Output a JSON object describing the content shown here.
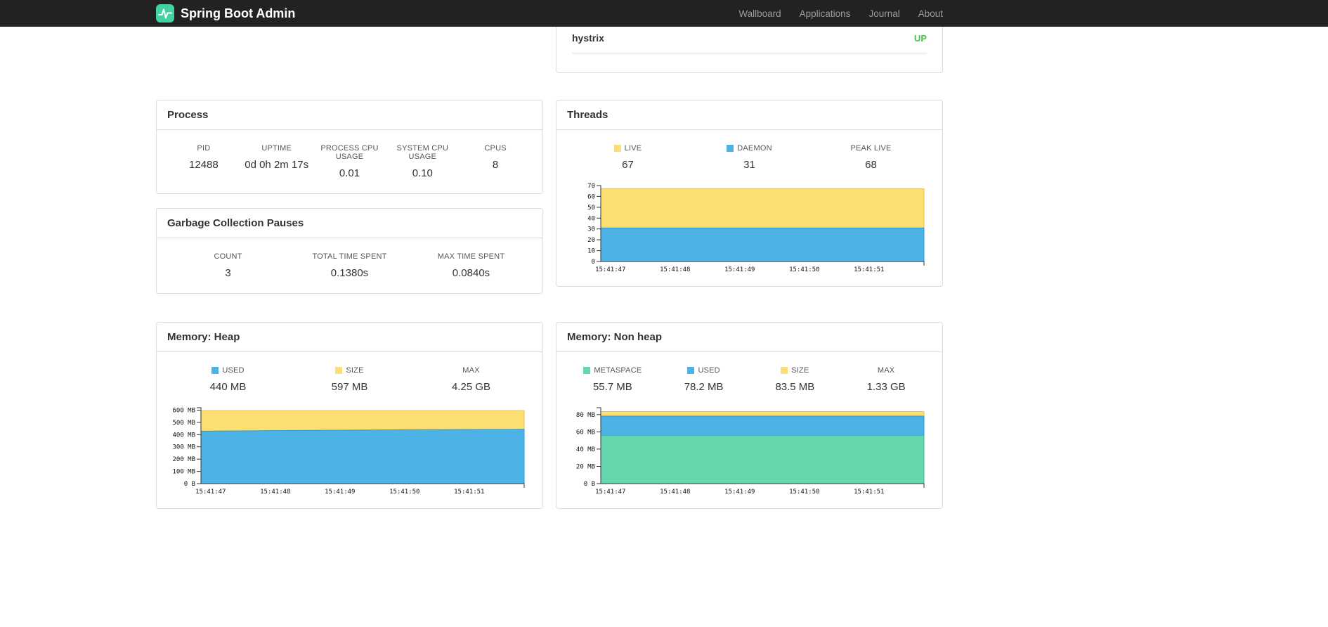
{
  "navbar": {
    "brand": "Spring Boot Admin",
    "items": [
      {
        "label": "Wallboard"
      },
      {
        "label": "Applications"
      },
      {
        "label": "Journal"
      },
      {
        "label": "About"
      }
    ]
  },
  "colors": {
    "navbar_bg": "#222222",
    "brand_logo": "#42d3a5",
    "nav_link": "#9d9d9d",
    "status_up": "#4bc14b",
    "panel_border": "#dddddd",
    "series_yellow": "#fbdf73",
    "series_blue": "#4db3e6",
    "series_green": "#66d7ad"
  },
  "health": {
    "rows": [
      {
        "name": "hystrix",
        "status": "UP"
      }
    ]
  },
  "process": {
    "title": "Process",
    "stats": [
      {
        "label": "PID",
        "value": "12488"
      },
      {
        "label": "UPTIME",
        "value": "0d 0h 2m 17s"
      },
      {
        "label": "PROCESS CPU USAGE",
        "value": "0.01"
      },
      {
        "label": "SYSTEM CPU USAGE",
        "value": "0.10"
      },
      {
        "label": "CPUS",
        "value": "8"
      }
    ]
  },
  "gc": {
    "title": "Garbage Collection Pauses",
    "stats": [
      {
        "label": "COUNT",
        "value": "3"
      },
      {
        "label": "TOTAL TIME SPENT",
        "value": "0.1380s"
      },
      {
        "label": "MAX TIME SPENT",
        "value": "0.0840s"
      }
    ]
  },
  "threads": {
    "title": "Threads",
    "stats": [
      {
        "label": "LIVE",
        "color": "#fbdf73",
        "value": "67"
      },
      {
        "label": "DAEMON",
        "color": "#4db3e6",
        "value": "31"
      },
      {
        "label": "PEAK LIVE",
        "value": "68"
      }
    ]
  },
  "heap": {
    "title": "Memory: Heap",
    "stats": [
      {
        "label": "USED",
        "color": "#4db3e6",
        "value": "440 MB"
      },
      {
        "label": "SIZE",
        "color": "#fbdf73",
        "value": "597 MB"
      },
      {
        "label": "MAX",
        "value": "4.25 GB"
      }
    ]
  },
  "nonheap": {
    "title": "Memory: Non heap",
    "stats": [
      {
        "label": "METASPACE",
        "color": "#66d7ad",
        "value": "55.7 MB"
      },
      {
        "label": "USED",
        "color": "#4db3e6",
        "value": "78.2 MB"
      },
      {
        "label": "SIZE",
        "color": "#fbdf73",
        "value": "83.5 MB"
      },
      {
        "label": "MAX",
        "value": "1.33 GB"
      }
    ]
  },
  "chart_data": [
    {
      "id": "threads",
      "type": "area",
      "title": "Threads",
      "x": [
        "15:41:47",
        "15:41:48",
        "15:41:49",
        "15:41:50",
        "15:41:51"
      ],
      "xtick_pos": [
        0.03,
        0.23,
        0.43,
        0.63,
        0.83
      ],
      "series": [
        {
          "name": "LIVE",
          "color": "#fbdf73",
          "stroke": "#e8c74e",
          "values": [
            67,
            67,
            67,
            67,
            67,
            67
          ]
        },
        {
          "name": "DAEMON",
          "color": "#4db3e6",
          "stroke": "#2f9ad1",
          "values": [
            31,
            31,
            31,
            31,
            31,
            31
          ]
        }
      ],
      "ylim": [
        0,
        70
      ],
      "yticks": [
        0,
        10,
        20,
        30,
        40,
        50,
        60,
        70
      ],
      "ytick_labels": [
        "0",
        "10",
        "20",
        "30",
        "40",
        "50",
        "60",
        "70"
      ],
      "legend_position": "top"
    },
    {
      "id": "heap",
      "type": "area",
      "title": "Memory: Heap",
      "x": [
        "15:41:47",
        "15:41:48",
        "15:41:49",
        "15:41:50",
        "15:41:51"
      ],
      "xtick_pos": [
        0.03,
        0.23,
        0.43,
        0.63,
        0.83
      ],
      "series": [
        {
          "name": "SIZE",
          "color": "#fbdf73",
          "stroke": "#e8c74e",
          "values": [
            597,
            597,
            597,
            597,
            597,
            597
          ]
        },
        {
          "name": "USED",
          "color": "#4db3e6",
          "stroke": "#2f9ad1",
          "values": [
            428,
            432,
            436,
            439,
            442,
            444
          ]
        }
      ],
      "ylim": [
        0,
        620
      ],
      "yticks": [
        0,
        100,
        200,
        300,
        400,
        500,
        600
      ],
      "ytick_labels": [
        "0 B",
        "100 MB",
        "200 MB",
        "300 MB",
        "400 MB",
        "500 MB",
        "600 MB"
      ],
      "legend_position": "top"
    },
    {
      "id": "nonheap",
      "type": "area",
      "title": "Memory: Non heap",
      "x": [
        "15:41:47",
        "15:41:48",
        "15:41:49",
        "15:41:50",
        "15:41:51"
      ],
      "xtick_pos": [
        0.03,
        0.23,
        0.43,
        0.63,
        0.83
      ],
      "series": [
        {
          "name": "SIZE",
          "color": "#fbdf73",
          "stroke": "#e8c74e",
          "values": [
            83.5,
            83.5,
            83.5,
            83.5,
            83.5,
            83.5
          ]
        },
        {
          "name": "USED",
          "color": "#4db3e6",
          "stroke": "#2f9ad1",
          "values": [
            78.2,
            78.2,
            78.2,
            78.2,
            78.2,
            78.2
          ]
        },
        {
          "name": "METASPACE",
          "color": "#66d7ad",
          "stroke": "#3fbd8f",
          "values": [
            55.7,
            55.7,
            55.7,
            55.7,
            55.7,
            55.7
          ]
        }
      ],
      "ylim": [
        0,
        88
      ],
      "yticks": [
        0,
        20,
        40,
        60,
        80
      ],
      "ytick_labels": [
        "0 B",
        "20 MB",
        "40 MB",
        "60 MB",
        "80 MB"
      ],
      "legend_position": "top"
    }
  ]
}
